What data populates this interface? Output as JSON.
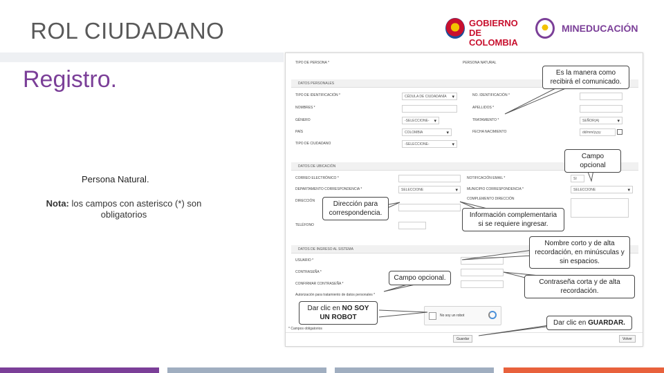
{
  "header": {
    "title": "ROL CIUDADANO",
    "subtitle": "Registro.",
    "logo_gobierno_line1": "GOBIERNO",
    "logo_gobierno_line2": "DE COLOMBIA",
    "logo_mineducacion": "MINEDUCACIÓN"
  },
  "left": {
    "persona": "Persona Natural.",
    "nota_label": "Nota:",
    "nota_text": " los campos con asterisco (*) son obligatorios"
  },
  "form": {
    "tipo_persona_label": "TIPO DE PERSONA *",
    "persona_value": "PERSONA NATURAL",
    "sec_personales": "DATOS PERSONALES",
    "tipo_id_label": "TIPO DE IDENTIFICACIÓN *",
    "tipo_id_value": "CÉDULA DE CIUDADANÍA",
    "num_id_label": "NO. IDENTIFICACIÓN *",
    "nombres_label": "NOMBRES *",
    "apellidos_label": "APELLIDOS *",
    "genero_label": "GÉNERO",
    "genero_value": "-SELECCIONE-",
    "tratamiento_label": "TRATAMIENTO *",
    "tratamiento_value": "SEÑOR(A)",
    "pais_label": "PAÍS",
    "pais_value": "COLOMBIA",
    "fecha_label": "FECHA NACIMIENTO",
    "fecha_value": "dd/mm/yyyy",
    "tipo_ciudadano_label": "TIPO DE CIUDADANO",
    "tipo_ciudadano_value": "-SELECCIONE-",
    "sec_ubicacion": "DATOS DE UBICACIÓN",
    "correo_label": "CORREO ELECTRÓNICO *",
    "notificacion_label": "NOTIFICACIÓN EMAIL *",
    "notificacion_value": "SI",
    "depto_label": "DEPARTAMENTO CORRESPONDENCIA *",
    "depto_value": "SELECCIONE",
    "municipio_label": "MUNICIPIO CORRESPONDENCIA *",
    "municipio_value": "SELECCIONE",
    "direccion_label": "DIRECCIÓN",
    "complemento_label": "COMPLEMENTO DIRECCIÓN",
    "telefono_label": "TELÉFONO",
    "sec_sistema": "DATOS DE INGRESO AL SISTEMA",
    "usuario_label": "USUARIO *",
    "contrasena_label": "CONTRASEÑA *",
    "confirmar_label": "CONFIRMAR CONTRASEÑA *",
    "autorizacion_label": "Autorización para tratamiento de datos personales *",
    "captcha_label": "No soy un robot",
    "campos_label": "* Campos obligatorios",
    "guardar_label": "Guardar",
    "volver_label": "Volver"
  },
  "callouts": {
    "c1": "Es la manera como recibirá el comunicado.",
    "c2": "Campo opcional",
    "c3": "Dirección para correspondencia.",
    "c4": "Información complementaria si se requiere ingresar.",
    "c5": "Nombre corto y de alta recordación, en minúsculas y sin espacios.",
    "c6": "Campo opcional.",
    "c7": "Contraseña corta y de alta recordación.",
    "c8_pre": "Dar clic en ",
    "c8_bold": "NO SOY UN ROBOT",
    "c9_pre": "Dar clic en ",
    "c9_bold": "GUARDAR."
  },
  "colors": {
    "bar1": "#7b3f98",
    "bar2": "#a0aec0",
    "bar3": "#a0aec0",
    "bar4": "#e8613c"
  }
}
